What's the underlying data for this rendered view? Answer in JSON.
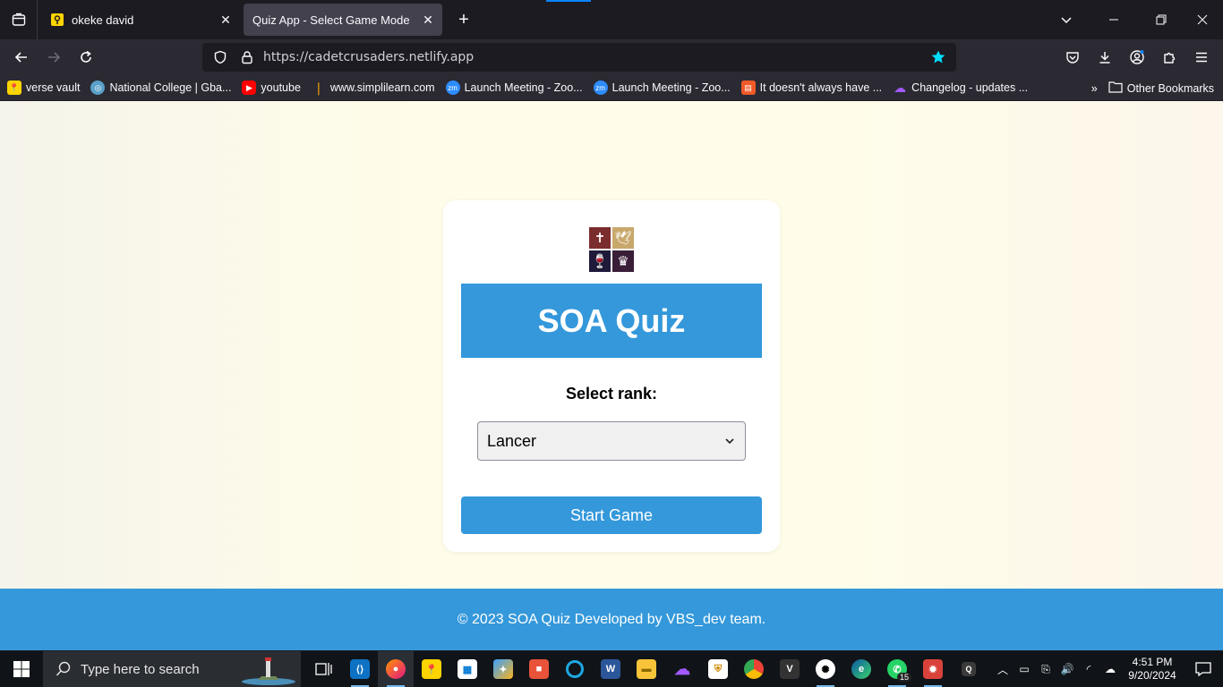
{
  "browser": {
    "tabs": [
      {
        "title": "okeke david",
        "favicon": "yellow-pin-icon"
      },
      {
        "title": "Quiz App - Select Game Mode",
        "favicon": "none"
      }
    ],
    "url": "https://cadetcrusaders.netlify.app",
    "bookmarks": [
      {
        "label": "verse vault",
        "icon": "yellow-pin-icon",
        "color": "#ffd400"
      },
      {
        "label": "National College | Gba...",
        "icon": "college-crest-icon",
        "color": "#5aa0c8"
      },
      {
        "label": "youtube",
        "icon": "youtube-icon",
        "color": "#ff0000"
      },
      {
        "label": "www.simplilearn.com",
        "icon": "simplilearn-icon",
        "color": "#f4a300"
      },
      {
        "label": "Launch Meeting - Zoo...",
        "icon": "zoom-icon",
        "color": "#2d8cff"
      },
      {
        "label": "Launch Meeting - Zoo...",
        "icon": "zoom-icon",
        "color": "#2d8cff"
      },
      {
        "label": "It doesn't always have ...",
        "icon": "bookmark-orange-icon",
        "color": "#f05a28"
      },
      {
        "label": "Changelog - updates ...",
        "icon": "cloud-purple-icon",
        "color": "#a259ff"
      }
    ],
    "other_bookmarks": "Other Bookmarks"
  },
  "page": {
    "title": "SOA Quiz",
    "rank_label": "Select rank:",
    "rank_selected": "Lancer",
    "start_button": "Start Game",
    "footer": "© 2023 SOA Quiz Developed by VBS_dev team.",
    "accent": "#3498db"
  },
  "taskbar": {
    "search_placeholder": "Type here to search",
    "whatsapp_badge": "15",
    "time": "4:51 PM",
    "date": "9/20/2024"
  }
}
